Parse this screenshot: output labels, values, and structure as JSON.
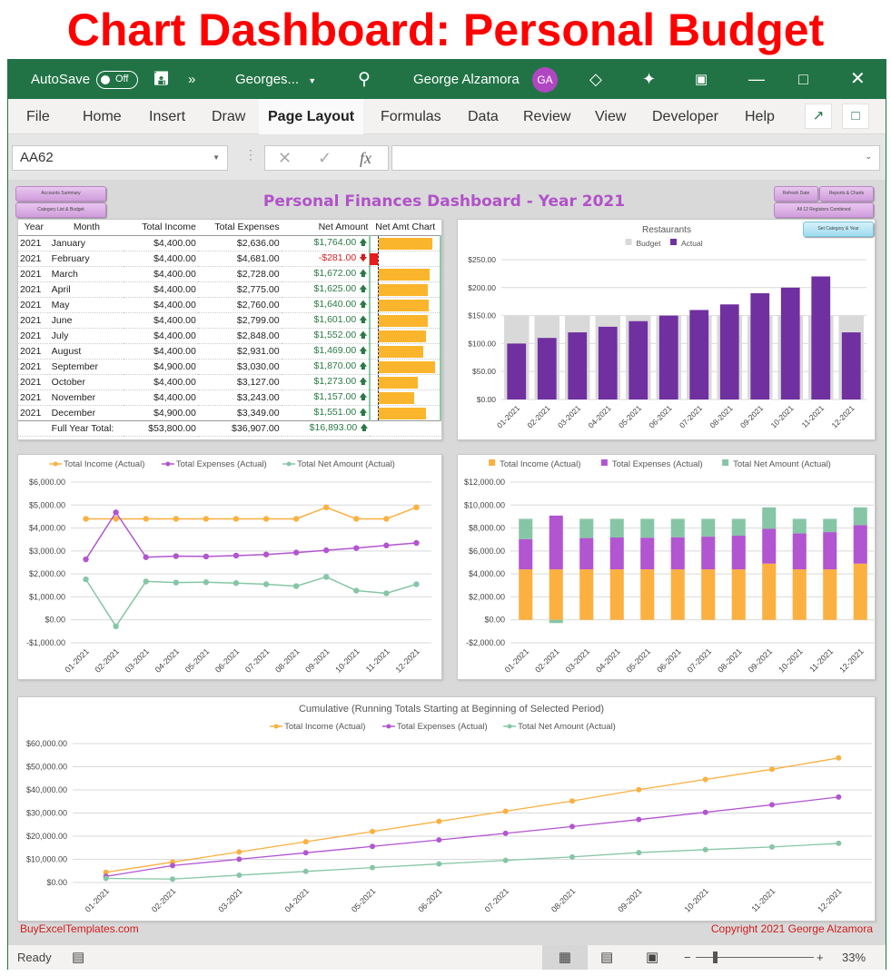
{
  "banner": "Chart Dashboard: Personal Budget",
  "titlebar": {
    "autosave_label": "AutoSave",
    "autosave_state": "Off",
    "overflow": "»",
    "filename": "Georges...",
    "user_name": "George Alzamora",
    "user_initials": "GA"
  },
  "menu": {
    "items": [
      "File",
      "Home",
      "Insert",
      "Draw",
      "Page Layout",
      "Formulas",
      "Data",
      "Review",
      "View",
      "Developer",
      "Help"
    ],
    "active": "Page Layout"
  },
  "formula_bar": {
    "name_box": "AA62",
    "fx": "fx",
    "value": ""
  },
  "sheet": {
    "title": "Personal Finances Dashboard - Year 2021",
    "buttons": {
      "accounts_summary": "Accounts Summary",
      "category_list": "Category List & Budget",
      "refresh_date": "Refresh Date",
      "reports_charts": "Reports & Charts",
      "all_regions": "All 12 Registers Combined",
      "set_category": "Set Category & Year"
    },
    "table": {
      "headers": [
        "Year",
        "Month",
        "Total Income",
        "Total Expenses",
        "Net Amount",
        "Net Amt Chart"
      ],
      "rows": [
        {
          "year": "2021",
          "month": "January",
          "income": "$4,400.00",
          "expenses": "$2,636.00",
          "net": "$1,764.00",
          "net_value": 1764
        },
        {
          "year": "2021",
          "month": "February",
          "income": "$4,400.00",
          "expenses": "$4,681.00",
          "net": "-$281.00",
          "net_value": -281
        },
        {
          "year": "2021",
          "month": "March",
          "income": "$4,400.00",
          "expenses": "$2,728.00",
          "net": "$1,672.00",
          "net_value": 1672
        },
        {
          "year": "2021",
          "month": "April",
          "income": "$4,400.00",
          "expenses": "$2,775.00",
          "net": "$1,625.00",
          "net_value": 1625
        },
        {
          "year": "2021",
          "month": "May",
          "income": "$4,400.00",
          "expenses": "$2,760.00",
          "net": "$1,640.00",
          "net_value": 1640
        },
        {
          "year": "2021",
          "month": "June",
          "income": "$4,400.00",
          "expenses": "$2,799.00",
          "net": "$1,601.00",
          "net_value": 1601
        },
        {
          "year": "2021",
          "month": "July",
          "income": "$4,400.00",
          "expenses": "$2,848.00",
          "net": "$1,552.00",
          "net_value": 1552
        },
        {
          "year": "2021",
          "month": "August",
          "income": "$4,400.00",
          "expenses": "$2,931.00",
          "net": "$1,469.00",
          "net_value": 1469
        },
        {
          "year": "2021",
          "month": "September",
          "income": "$4,900.00",
          "expenses": "$3,030.00",
          "net": "$1,870.00",
          "net_value": 1870
        },
        {
          "year": "2021",
          "month": "October",
          "income": "$4,400.00",
          "expenses": "$3,127.00",
          "net": "$1,273.00",
          "net_value": 1273
        },
        {
          "year": "2021",
          "month": "November",
          "income": "$4,400.00",
          "expenses": "$3,243.00",
          "net": "$1,157.00",
          "net_value": 1157
        },
        {
          "year": "2021",
          "month": "December",
          "income": "$4,900.00",
          "expenses": "$3,349.00",
          "net": "$1,551.00",
          "net_value": 1551
        }
      ],
      "total": {
        "label": "Full Year Total:",
        "income": "$53,800.00",
        "expenses": "$36,907.00",
        "net": "$16,893.00"
      }
    },
    "footer_left": "BuyExcelTemplates.com",
    "footer_right": "Copyright 2021 George Alzamora"
  },
  "colors": {
    "income": "#fbb040",
    "expenses": "#b255d0",
    "net": "#86c6a6",
    "actual": "#7030a0",
    "budget": "#d9d9d9",
    "excel_green": "#217346"
  },
  "chart_data": [
    {
      "type": "bar",
      "title": "Restaurants",
      "categories": [
        "01-2021",
        "02-2021",
        "03-2021",
        "04-2021",
        "05-2021",
        "06-2021",
        "07-2021",
        "08-2021",
        "09-2021",
        "10-2021",
        "11-2021",
        "12-2021"
      ],
      "series": [
        {
          "name": "Budget",
          "values": [
            150,
            150,
            150,
            150,
            150,
            150,
            150,
            150,
            150,
            150,
            150,
            150
          ]
        },
        {
          "name": "Actual",
          "values": [
            100,
            110,
            120,
            130,
            140,
            150,
            160,
            170,
            190,
            200,
            220,
            120
          ]
        }
      ],
      "yticks": [
        "$0.00",
        "$50.00",
        "$100.00",
        "$150.00",
        "$200.00",
        "$250.00"
      ],
      "ylim": [
        0,
        250
      ],
      "legend": "top",
      "grid": true
    },
    {
      "type": "line",
      "title": "",
      "categories": [
        "01-2021",
        "02-2021",
        "03-2021",
        "04-2021",
        "05-2021",
        "06-2021",
        "07-2021",
        "08-2021",
        "09-2021",
        "10-2021",
        "11-2021",
        "12-2021"
      ],
      "series": [
        {
          "name": "Total Income (Actual)",
          "values": [
            4400,
            4400,
            4400,
            4400,
            4400,
            4400,
            4400,
            4400,
            4900,
            4400,
            4400,
            4900
          ]
        },
        {
          "name": "Total Expenses (Actual)",
          "values": [
            2636,
            4681,
            2728,
            2775,
            2760,
            2799,
            2848,
            2931,
            3030,
            3127,
            3243,
            3349
          ]
        },
        {
          "name": "Total Net Amount (Actual)",
          "values": [
            1764,
            -281,
            1672,
            1625,
            1640,
            1601,
            1552,
            1469,
            1870,
            1273,
            1157,
            1551
          ]
        }
      ],
      "yticks": [
        "-$1,000.00",
        "$0.00",
        "$1,000.00",
        "$2,000.00",
        "$3,000.00",
        "$4,000.00",
        "$5,000.00",
        "$6,000.00"
      ],
      "ylim": [
        -1000,
        6000
      ],
      "legend": "top",
      "grid": true
    },
    {
      "type": "bar",
      "stacked": true,
      "title": "",
      "categories": [
        "01-2021",
        "02-2021",
        "03-2021",
        "04-2021",
        "05-2021",
        "06-2021",
        "07-2021",
        "08-2021",
        "09-2021",
        "10-2021",
        "11-2021",
        "12-2021"
      ],
      "series": [
        {
          "name": "Total Income (Actual)",
          "values": [
            4400,
            4400,
            4400,
            4400,
            4400,
            4400,
            4400,
            4400,
            4900,
            4400,
            4400,
            4900
          ]
        },
        {
          "name": "Total Expenses (Actual)",
          "values": [
            2636,
            4681,
            2728,
            2775,
            2760,
            2799,
            2848,
            2931,
            3030,
            3127,
            3243,
            3349
          ]
        },
        {
          "name": "Total Net Amount (Actual)",
          "values": [
            1764,
            -281,
            1672,
            1625,
            1640,
            1601,
            1552,
            1469,
            1870,
            1273,
            1157,
            1551
          ]
        }
      ],
      "yticks": [
        "-$2,000.00",
        "$0.00",
        "$2,000.00",
        "$4,000.00",
        "$6,000.00",
        "$8,000.00",
        "$10,000.00",
        "$12,000.00"
      ],
      "ylim": [
        -2000,
        12000
      ],
      "legend": "top",
      "grid": true
    },
    {
      "type": "line",
      "title": "Cumulative (Running Totals Starting at Beginning of Selected Period)",
      "categories": [
        "01-2021",
        "02-2021",
        "03-2021",
        "04-2021",
        "05-2021",
        "06-2021",
        "07-2021",
        "08-2021",
        "09-2021",
        "10-2021",
        "11-2021",
        "12-2021"
      ],
      "series": [
        {
          "name": "Total Income (Actual)",
          "values": [
            4400,
            8800,
            13200,
            17600,
            22000,
            26400,
            30800,
            35200,
            40100,
            44500,
            48900,
            53800
          ]
        },
        {
          "name": "Total Expenses (Actual)",
          "values": [
            2636,
            7317,
            10045,
            12820,
            15580,
            18379,
            21227,
            24158,
            27188,
            30315,
            33558,
            36907
          ]
        },
        {
          "name": "Total Net Amount (Actual)",
          "values": [
            1764,
            1483,
            3155,
            4780,
            6420,
            8021,
            9573,
            11042,
            12912,
            14185,
            15342,
            16893
          ]
        }
      ],
      "yticks": [
        "$0.00",
        "$10,000.00",
        "$20,000.00",
        "$30,000.00",
        "$40,000.00",
        "$50,000.00",
        "$60,000.00"
      ],
      "ylim": [
        0,
        60000
      ],
      "legend": "top",
      "grid": true
    }
  ],
  "status": {
    "ready": "Ready",
    "zoom": "33%",
    "minus": "−",
    "plus": "+"
  }
}
